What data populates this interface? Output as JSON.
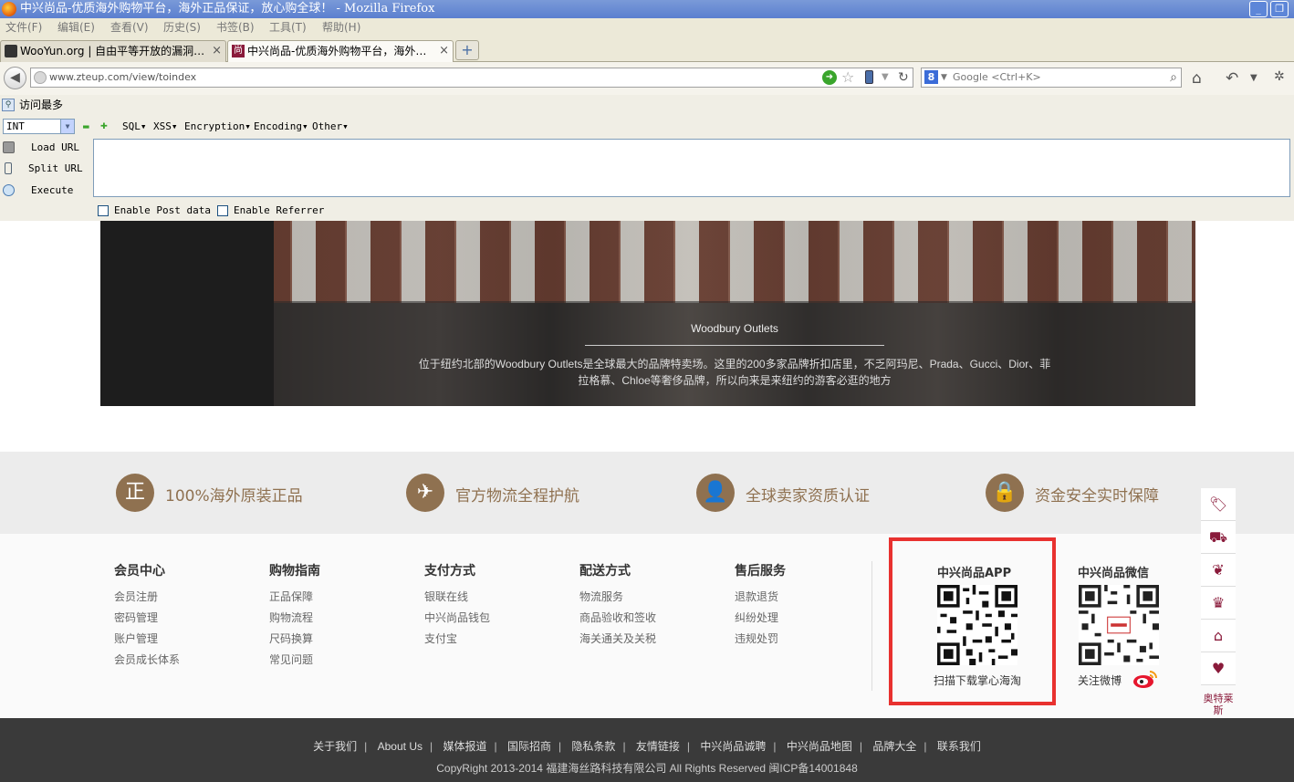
{
  "window": {
    "title": "中兴尚品-优质海外购物平台，海外正品保证，放心购全球！ - Mozilla Firefox",
    "minimize": "_",
    "restore": "❐"
  },
  "menubar": [
    "文件(F)",
    "编辑(E)",
    "查看(V)",
    "历史(S)",
    "书签(B)",
    "工具(T)",
    "帮助(H)"
  ],
  "tabs": [
    {
      "label": "WooYun.org | 自由平等开放的漏洞…",
      "close": "×"
    },
    {
      "label": "中兴尚品-优质海外购物平台，海外…",
      "close": "×",
      "favicon": "尚"
    }
  ],
  "newtab": "+",
  "nav": {
    "url": "www.zteup.com/view/toindex",
    "search_placeholder": "Google <Ctrl+K>",
    "search_engine_letter": "8"
  },
  "bookmarks": {
    "label": "访问最多"
  },
  "hackbar": {
    "select_value": "INT",
    "menus": [
      "SQL▾",
      "XSS▾",
      "Encryption▾",
      "Encoding▾",
      "Other▾"
    ],
    "actions": [
      "Load URL",
      "Split URL",
      "Execute"
    ],
    "checks": [
      "Enable Post data",
      "Enable Referrer"
    ]
  },
  "banner": {
    "title": "Woodbury Outlets",
    "text": "位于纽约北部的Woodbury Outlets是全球最大的品牌特卖场。这里的200多家品牌折扣店里，不乏阿玛尼、Prada、Gucci、Dior、菲拉格慕、Chloe等奢侈品牌，所以向来是来纽约的游客必逛的地方"
  },
  "guarantees": [
    {
      "icon": "正",
      "text": "100%海外原装正品"
    },
    {
      "icon": "✈",
      "text": "官方物流全程护航"
    },
    {
      "icon": "👤",
      "text": "全球卖家资质认证"
    },
    {
      "icon": "🔒",
      "text": "资金安全实时保障"
    }
  ],
  "footer_columns": [
    {
      "heading": "会员中心",
      "links": [
        "会员注册",
        "密码管理",
        "账户管理",
        "会员成长体系"
      ]
    },
    {
      "heading": "购物指南",
      "links": [
        "正品保障",
        "购物流程",
        "尺码换算",
        "常见问题"
      ]
    },
    {
      "heading": "支付方式",
      "links": [
        "银联在线",
        "中兴尚品钱包",
        "支付宝"
      ]
    },
    {
      "heading": "配送方式",
      "links": [
        "物流服务",
        "商品验收和签收",
        "海关通关及关税"
      ]
    },
    {
      "heading": "售后服务",
      "links": [
        "退款退货",
        "纠纷处理",
        "违规处罚"
      ]
    }
  ],
  "app": {
    "title": "中兴尚品APP",
    "caption": "扫描下载掌心海淘"
  },
  "wechat": {
    "title": "中兴尚品微信",
    "caption": "关注微博"
  },
  "sidebar": {
    "text": "奥特莱斯",
    "top": "︿"
  },
  "bottom": {
    "links": [
      "关于我们",
      "About Us",
      "媒体报道",
      "国际招商",
      "隐私条款",
      "友情链接",
      "中兴尚品诚聘",
      "中兴尚品地图",
      "品牌大全",
      "联系我们"
    ],
    "copyright": "CopyRight 2013-2014 福建海丝路科技有限公司 All Rights Reserved 闽ICP备14001848"
  }
}
